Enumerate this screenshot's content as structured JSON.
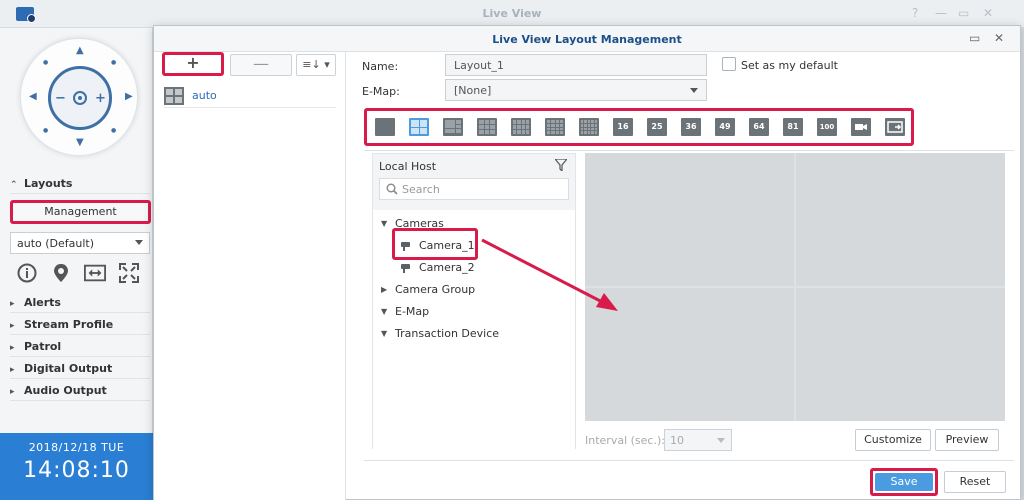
{
  "outer_window": {
    "title": "Live View",
    "controls": [
      "?",
      "—",
      "▭",
      "✕"
    ]
  },
  "left_panel": {
    "sections": {
      "layouts": "Layouts",
      "alerts": "Alerts",
      "stream_profile": "Stream Profile",
      "patrol": "Patrol",
      "digital_output": "Digital Output",
      "audio_output": "Audio Output"
    },
    "management_label": "Management",
    "layout_select_value": "auto (Default)",
    "clock": {
      "date": "2018/12/18 TUE",
      "time": "14:08:10"
    }
  },
  "dialog": {
    "title": "Live View Layout Management",
    "add_label": "+",
    "remove_label": "—",
    "sort_label": "≡↓ ▾",
    "layouts": [
      {
        "name": "auto"
      }
    ],
    "name_label": "Name:",
    "name_value": "Layout_1",
    "default_label": "Set as my default",
    "emap_label": "E-Map:",
    "emap_value": "[None]",
    "layout_buttons": [
      "16",
      "25",
      "36",
      "49",
      "64",
      "81",
      "100"
    ],
    "tree": {
      "header": "Local Host",
      "search_placeholder": "Search",
      "cameras": "Cameras",
      "camera_1": "Camera_1",
      "camera_2": "Camera_2",
      "camera_group": "Camera Group",
      "emap": "E-Map",
      "transaction_device": "Transaction Device"
    },
    "interval_label": "Interval (sec.):",
    "interval_value": "10",
    "customize_label": "Customize",
    "preview_label": "Preview",
    "save_label": "Save",
    "reset_label": "Reset"
  },
  "colors": {
    "highlight": "#d81b4a",
    "accent": "#4a9be0",
    "clock_bg": "#2a7fd4"
  }
}
